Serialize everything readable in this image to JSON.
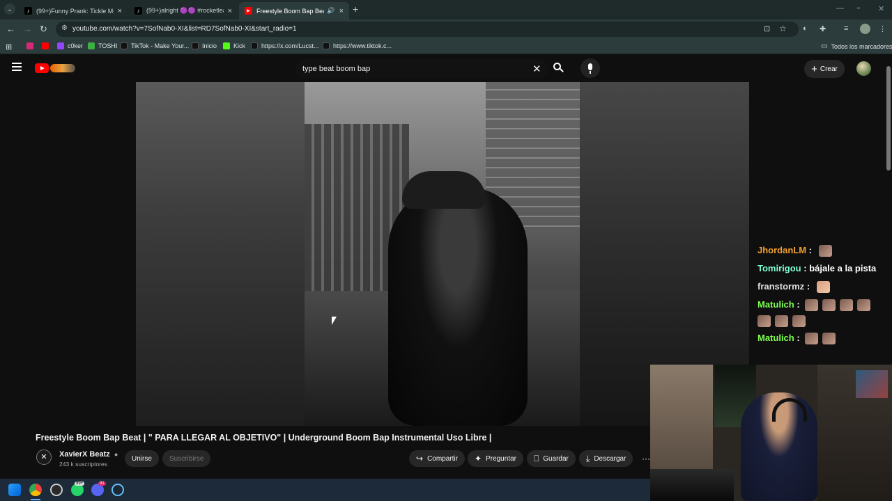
{
  "browser": {
    "tabs": [
      {
        "label": "(99+)Funny Prank: Tickle Monst",
        "icon": "tiktok-icon",
        "active": false
      },
      {
        "label": "(99+)alright 🟣🟣 #rocketleag",
        "icon": "tiktok-icon",
        "active": false
      },
      {
        "label": "Freestyle Boom Bap Beat | \"",
        "icon": "youtube-icon",
        "active": true
      }
    ],
    "new_tab": "+",
    "url": "youtube.com/watch?v=7SofNab0-XI&list=RD7SofNab0-XI&start_radio=1",
    "bookmarks": [
      {
        "label": "",
        "icon": "instagram-icon",
        "color": "#d62976"
      },
      {
        "label": "",
        "icon": "youtube-icon",
        "color": "#ff0000"
      },
      {
        "label": "c0ker",
        "icon": "twitch-icon",
        "color": "#9146ff"
      },
      {
        "label": "TOSHI",
        "icon": "bookmark-icon",
        "color": "#3cb043"
      },
      {
        "label": "TikTok - Make Your...",
        "icon": "tiktok-icon",
        "color": "#222222"
      },
      {
        "label": "Inicio",
        "icon": "x-icon",
        "color": "#222222"
      },
      {
        "label": "Kick",
        "icon": "kick-icon",
        "color": "#53fc18"
      },
      {
        "label": "https://x.com/Lucst...",
        "icon": "x-icon",
        "color": "#222222"
      },
      {
        "label": "https://www.tiktok.c...",
        "icon": "tiktok-icon",
        "color": "#222222"
      }
    ],
    "all_bookmarks": "Todos los marcadores"
  },
  "youtube": {
    "search_value": "type beat boom bap",
    "create_label": "Crear",
    "video_title": "Freestyle Boom Bap Beat | \" PARA LLEGAR AL OBJETIVO\" | Underground Boom Bap Instrumental Uso Libre |",
    "channel_name": "XavierX Beatz",
    "subscribers": "243 k suscriptores",
    "join_label": "Unirse",
    "subscribe_label": "Suscribirse",
    "actions": [
      {
        "label": "Compartir",
        "icon": "share-icon"
      },
      {
        "label": "Preguntar",
        "icon": "sparkle-icon"
      },
      {
        "label": "Guardar",
        "icon": "bookmark-icon"
      },
      {
        "label": "Descargar",
        "icon": "download-icon"
      }
    ],
    "more": "···"
  },
  "chat": [
    {
      "user": "JhordanLM",
      "sep": " :",
      "message": "",
      "emotes": 1,
      "color": "#f0a030"
    },
    {
      "user": "Tomirigou",
      "sep": " :",
      "message": " bájale a la pista",
      "emotes": 0,
      "color": "#7fffd4"
    },
    {
      "user": "franstormz",
      "sep": " :",
      "message": "",
      "emotes": 1,
      "color": "#e0e0e0"
    },
    {
      "user": "Matulich",
      "sep": " :",
      "message": "",
      "emotes": 7,
      "color": "#7fff50"
    },
    {
      "user": "Matulich",
      "sep": " :",
      "message": "",
      "emotes": 2,
      "color": "#7fff50"
    }
  ],
  "taskbar": {
    "whatsapp_badge": "99+",
    "discord_badge": "91"
  },
  "colors": {
    "youtube_red": "#ff0000",
    "chrome_frame": "#1f2b2b",
    "page_bg": "#0f0f0f"
  }
}
